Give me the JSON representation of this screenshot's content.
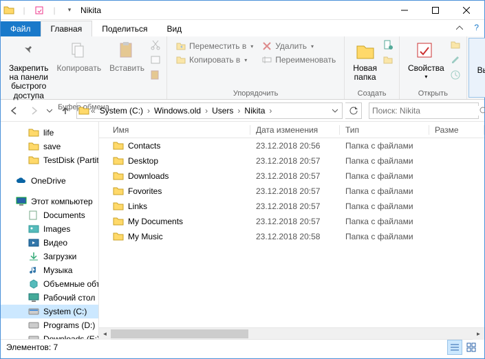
{
  "window": {
    "title": "Nikita"
  },
  "tabs": {
    "file": "Файл",
    "home": "Главная",
    "share": "Поделиться",
    "view": "Вид"
  },
  "ribbon": {
    "clipboard": {
      "pin": "Закрепить на панели\nбыстрого доступа",
      "copy": "Копировать",
      "paste": "Вставить",
      "label": "Буфер обмена"
    },
    "organize": {
      "moveto": "Переместить в",
      "copyto": "Копировать в",
      "delete": "Удалить",
      "rename": "Переименовать",
      "label": "Упорядочить"
    },
    "new": {
      "newfolder": "Новая\nпапка",
      "label": "Создать"
    },
    "open": {
      "props": "Свойства",
      "label": "Открыть"
    },
    "select": {
      "select": "Выделить",
      "label": ""
    }
  },
  "breadcrumbs": [
    "System (C:)",
    "Windows.old",
    "Users",
    "Nikita"
  ],
  "search": {
    "placeholder": "Поиск: Nikita"
  },
  "sidebar": {
    "quick": [
      "life",
      "save",
      "TestDisk (Partition Recovery)"
    ],
    "onedrive": "OneDrive",
    "thispc": "Этот компьютер",
    "thispc_items": [
      "Documents",
      "Images",
      "Видео",
      "Загрузки",
      "Музыка",
      "Объемные объекты",
      "Рабочий стол",
      "System (C:)",
      "Programs (D:)",
      "Downloads (E:)"
    ]
  },
  "columns": {
    "name": "Имя",
    "date": "Дата изменения",
    "type": "Тип",
    "size": "Разме"
  },
  "files": [
    {
      "name": "Contacts",
      "date": "23.12.2018 20:56",
      "type": "Папка с файлами"
    },
    {
      "name": "Desktop",
      "date": "23.12.2018 20:57",
      "type": "Папка с файлами"
    },
    {
      "name": "Downloads",
      "date": "23.12.2018 20:57",
      "type": "Папка с файлами"
    },
    {
      "name": "Fovorites",
      "date": "23.12.2018 20:57",
      "type": "Папка с файлами"
    },
    {
      "name": "Links",
      "date": "23.12.2018 20:57",
      "type": "Папка с файлами"
    },
    {
      "name": "My Documents",
      "date": "23.12.2018 20:57",
      "type": "Папка с файлами"
    },
    {
      "name": "My Music",
      "date": "23.12.2018 20:58",
      "type": "Папка с файлами"
    }
  ],
  "status": {
    "count": "Элементов: 7"
  }
}
